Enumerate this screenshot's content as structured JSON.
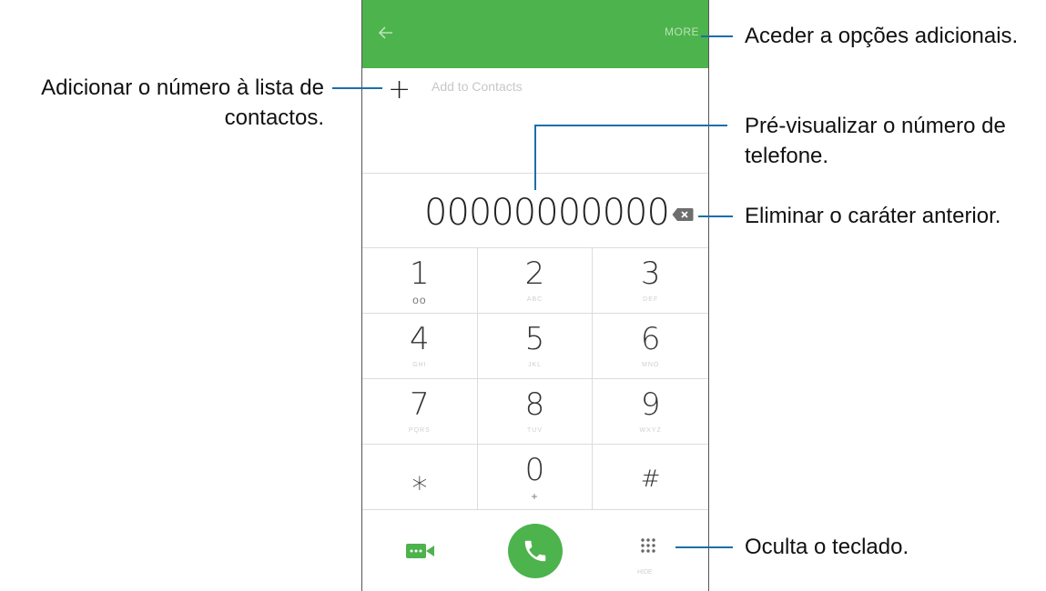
{
  "phone": {
    "appbar": {
      "more_label": "MORE"
    },
    "add_row": {
      "plus_glyph": "+",
      "label": "Add to Contacts"
    },
    "number": "00000000000",
    "keys": [
      {
        "digit": "1",
        "sub": "ᴏᴏ"
      },
      {
        "digit": "2",
        "sub": "ABC"
      },
      {
        "digit": "3",
        "sub": "DEF"
      },
      {
        "digit": "4",
        "sub": "GHI"
      },
      {
        "digit": "5",
        "sub": "JKL"
      },
      {
        "digit": "6",
        "sub": "MNO"
      },
      {
        "digit": "7",
        "sub": "PQRS"
      },
      {
        "digit": "8",
        "sub": "TUV"
      },
      {
        "digit": "9",
        "sub": "WXYZ"
      },
      {
        "digit": "⁎",
        "sub": ""
      },
      {
        "digit": "0",
        "sub": "+"
      },
      {
        "digit": "#",
        "sub": ""
      }
    ],
    "hide_label": "HIDE"
  },
  "callouts": {
    "more_options": "Aceder a opções adicionais.",
    "add_contact_line1": "Adicionar o número à lista de",
    "add_contact_line2": "contactos.",
    "preview_line1": "Pré-visualizar o número de",
    "preview_line2": "telefone.",
    "delete_prev": "Eliminar o caráter anterior.",
    "hide_keypad": "Oculta o teclado."
  },
  "colors": {
    "accent_green": "#4db34d",
    "callout_line": "#1a6fa8"
  },
  "icons": [
    "back-arrow-icon",
    "plus-icon",
    "backspace-icon",
    "voicemail-icon",
    "video-call-icon",
    "phone-icon",
    "dialpad-icon"
  ]
}
